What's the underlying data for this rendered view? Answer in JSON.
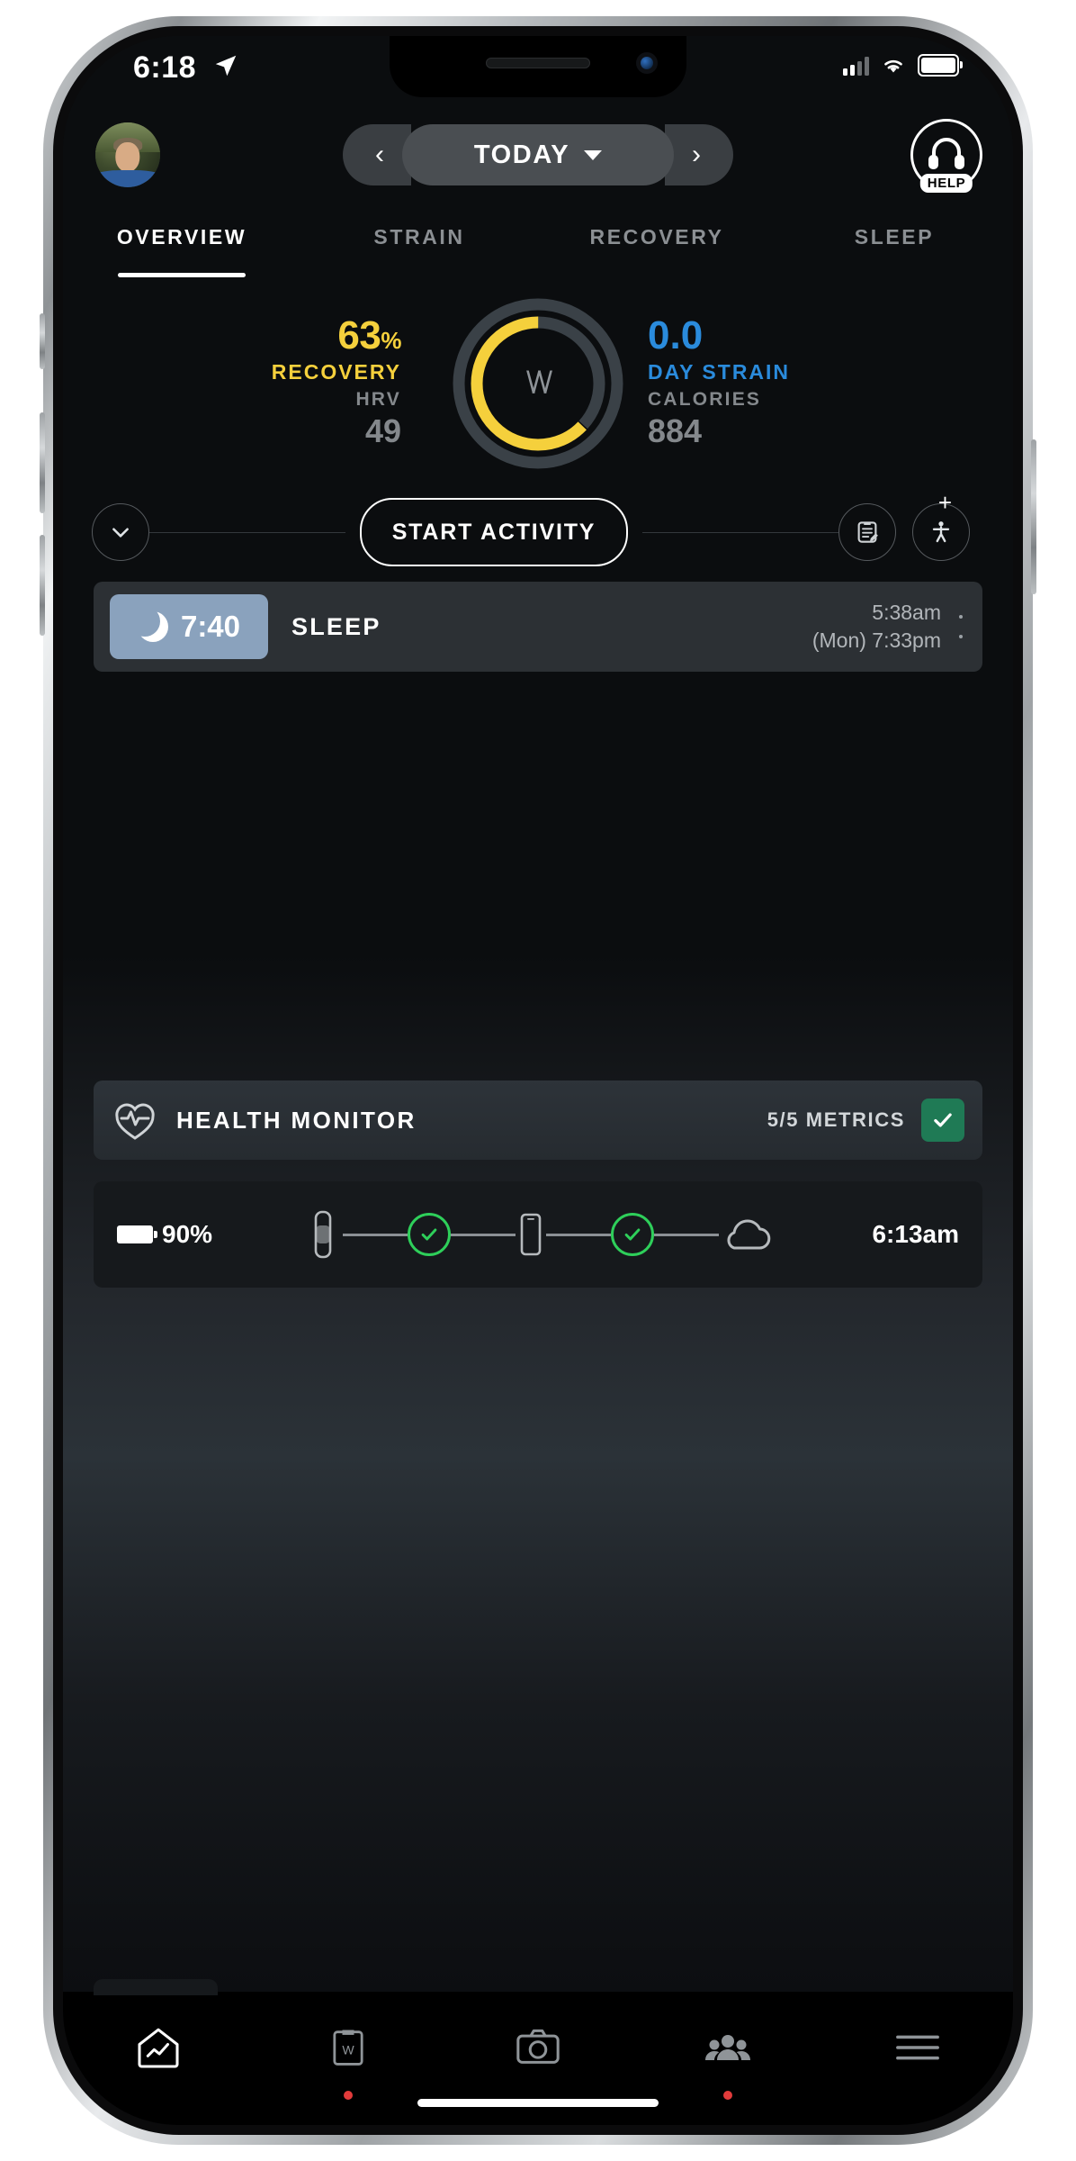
{
  "status_bar": {
    "time": "6:18",
    "location_icon": "location-arrow-icon",
    "signal_icon": "cellular-signal-icon",
    "wifi_icon": "wifi-icon",
    "battery_icon": "battery-full-icon"
  },
  "header": {
    "avatar": "user-avatar",
    "prev_label": "‹",
    "next_label": "›",
    "day_label": "TODAY",
    "help_label": "HELP"
  },
  "tabs": [
    {
      "label": "OVERVIEW",
      "active": true
    },
    {
      "label": "STRAIN",
      "active": false
    },
    {
      "label": "RECOVERY",
      "active": false
    },
    {
      "label": "SLEEP",
      "active": false
    }
  ],
  "summary": {
    "recovery_value": "63",
    "recovery_unit": "%",
    "recovery_label": "RECOVERY",
    "hrv_label": "HRV",
    "hrv_value": "49",
    "strain_value": "0.0",
    "strain_label": "DAY STRAIN",
    "calories_label": "CALORIES",
    "calories_value": "884",
    "logo": "whoop-logo",
    "recovery_color": "#f5d03c",
    "strain_color": "#2a8bdc",
    "ring_track_color": "#3a4147"
  },
  "actions": {
    "expand_icon": "chevron-down-icon",
    "start_label": "START ACTIVITY",
    "journal_icon": "journal-clipboard-icon",
    "add_activity_icon": "add-activity-icon",
    "plus_label": "+"
  },
  "sleep_card": {
    "moon_icon": "moon-icon",
    "duration": "7:40",
    "title": "SLEEP",
    "wake_time": "5:38am",
    "bed_time": "(Mon) 7:33pm",
    "badge_color": "#8aa2bd"
  },
  "health_monitor": {
    "icon": "heart-pulse-icon",
    "label": "HEALTH MONITOR",
    "metrics": "5/5 METRICS",
    "check_icon": "check-icon",
    "check_color": "#1f7a55"
  },
  "sync_card": {
    "battery_icon": "battery-icon",
    "battery_pct": "90%",
    "strap_icon": "whoop-strap-icon",
    "phone_icon": "phone-icon",
    "cloud_icon": "cloud-icon",
    "check_icon": "check-icon",
    "sync_time": "6:13am",
    "ok_color": "#2ecf5a"
  },
  "bottom_nav": [
    {
      "name": "home",
      "icon": "home-chart-icon",
      "badge": false
    },
    {
      "name": "journal",
      "icon": "journal-w-icon",
      "badge": true
    },
    {
      "name": "camera",
      "icon": "camera-icon",
      "badge": false
    },
    {
      "name": "community",
      "icon": "people-icon",
      "badge": true
    },
    {
      "name": "menu",
      "icon": "hamburger-menu-icon",
      "badge": false
    }
  ]
}
